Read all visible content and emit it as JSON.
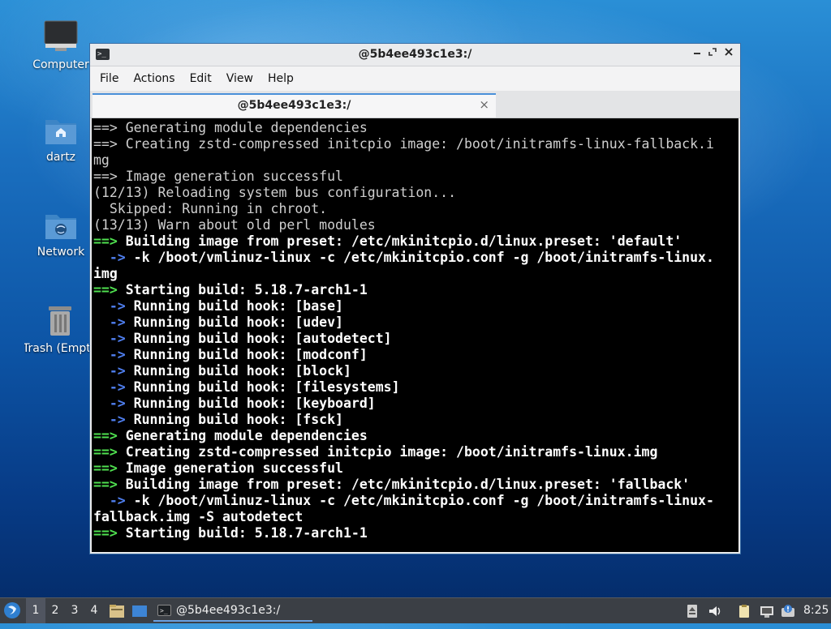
{
  "desktop": {
    "icons": [
      {
        "label": "Computer"
      },
      {
        "label": "dartz"
      },
      {
        "label": "Network"
      },
      {
        "label": "Trash (Empty)"
      }
    ]
  },
  "window": {
    "title": "@5b4ee493c1e3:/",
    "menu": [
      "File",
      "Actions",
      "Edit",
      "View",
      "Help"
    ],
    "tab": {
      "label": "@5b4ee493c1e3:/",
      "close": "×"
    },
    "controls": {
      "minimize": "▬",
      "maximize": "⤢",
      "close": "✕"
    }
  },
  "terminal": {
    "lines": [
      {
        "kind": "plain",
        "prefix": "==>",
        "text": " Generating module dependencies"
      },
      {
        "kind": "plain",
        "prefix": "==>",
        "text": " Creating zstd-compressed initcpio image: /boot/initramfs-linux-fallback.i"
      },
      {
        "kind": "plain",
        "prefix": "",
        "text": "mg"
      },
      {
        "kind": "plain",
        "prefix": "==>",
        "text": " Image generation successful"
      },
      {
        "kind": "plain",
        "prefix": "",
        "text": "(12/13) Reloading system bus configuration..."
      },
      {
        "kind": "plain",
        "prefix": "",
        "text": "  Skipped: Running in chroot."
      },
      {
        "kind": "plain",
        "prefix": "",
        "text": "(13/13) Warn about old perl modules"
      },
      {
        "kind": "green",
        "prefix": "==>",
        "text": " Building image from preset: /etc/mkinitcpio.d/linux.preset: 'default'"
      },
      {
        "kind": "blue",
        "prefix": "  ->",
        "text": " -k /boot/vmlinuz-linux -c /etc/mkinitcpio.conf -g /boot/initramfs-linux."
      },
      {
        "kind": "bold",
        "prefix": "",
        "text": "img"
      },
      {
        "kind": "green",
        "prefix": "==>",
        "text": " Starting build: 5.18.7-arch1-1"
      },
      {
        "kind": "blue",
        "prefix": "  ->",
        "text": " Running build hook: [base]"
      },
      {
        "kind": "blue",
        "prefix": "  ->",
        "text": " Running build hook: [udev]"
      },
      {
        "kind": "blue",
        "prefix": "  ->",
        "text": " Running build hook: [autodetect]"
      },
      {
        "kind": "blue",
        "prefix": "  ->",
        "text": " Running build hook: [modconf]"
      },
      {
        "kind": "blue",
        "prefix": "  ->",
        "text": " Running build hook: [block]"
      },
      {
        "kind": "blue",
        "prefix": "  ->",
        "text": " Running build hook: [filesystems]"
      },
      {
        "kind": "blue",
        "prefix": "  ->",
        "text": " Running build hook: [keyboard]"
      },
      {
        "kind": "blue",
        "prefix": "  ->",
        "text": " Running build hook: [fsck]"
      },
      {
        "kind": "green",
        "prefix": "==>",
        "text": " Generating module dependencies"
      },
      {
        "kind": "green",
        "prefix": "==>",
        "text": " Creating zstd-compressed initcpio image: /boot/initramfs-linux.img"
      },
      {
        "kind": "green",
        "prefix": "==>",
        "text": " Image generation successful"
      },
      {
        "kind": "green",
        "prefix": "==>",
        "text": " Building image from preset: /etc/mkinitcpio.d/linux.preset: 'fallback'"
      },
      {
        "kind": "blue",
        "prefix": "  ->",
        "text": " -k /boot/vmlinuz-linux -c /etc/mkinitcpio.conf -g /boot/initramfs-linux-"
      },
      {
        "kind": "bold",
        "prefix": "",
        "text": "fallback.img -S autodetect"
      },
      {
        "kind": "green",
        "prefix": "==>",
        "text": " Starting build: 5.18.7-arch1-1"
      }
    ]
  },
  "taskbar": {
    "workspaces": [
      "1",
      "2",
      "3",
      "4"
    ],
    "active_workspace": "1",
    "task": {
      "label": "@5b4ee493c1e3:/"
    },
    "tray_icons": [
      "eject-icon",
      "volume-icon",
      "clipboard-icon",
      "network-icon",
      "notification-icon"
    ],
    "clock": "8:25"
  },
  "colors": {
    "accent": "#4a90d9",
    "prompt_green": "#4fe04f",
    "arrow_blue": "#4f7ff0",
    "terminal_bg": "#000000"
  }
}
